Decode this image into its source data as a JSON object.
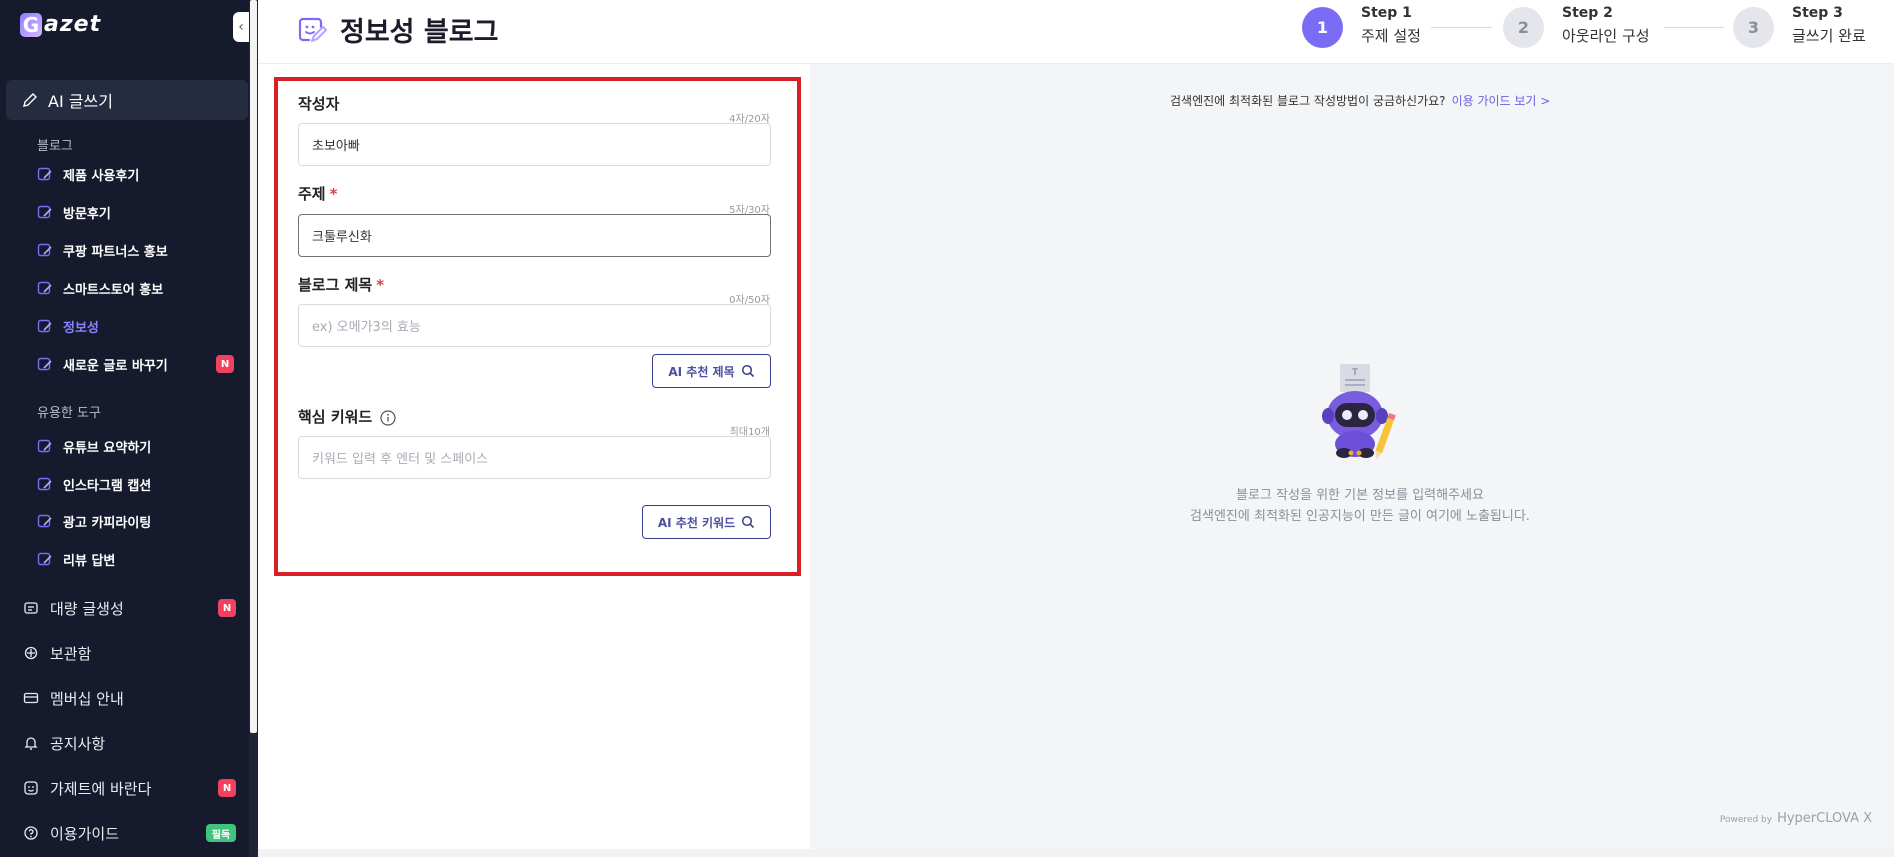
{
  "sidebar": {
    "logo": {
      "letter": "G",
      "text": "azet"
    },
    "collapse_glyph": "‹",
    "main_item": {
      "label": "AI 글쓰기",
      "icon": "pencil-icon"
    },
    "blog_section_label": "블로그",
    "blog_items": [
      {
        "label": "제품 사용후기"
      },
      {
        "label": "방문후기"
      },
      {
        "label": "쿠팡 파트너스 홍보"
      },
      {
        "label": "스마트스토어 홍보"
      },
      {
        "label": "정보성",
        "active": true
      },
      {
        "label": "새로운 글로 바꾸기",
        "badge": "N"
      }
    ],
    "tools_section_label": "유용한 도구",
    "tool_items": [
      {
        "label": "유튜브 요약하기"
      },
      {
        "label": "인스타그램 캡션"
      },
      {
        "label": "광고 카피라이팅"
      },
      {
        "label": "리뷰 답변"
      }
    ],
    "bottom_items": [
      {
        "label": "대량 글생성",
        "icon": "bulk-icon",
        "badge": "N"
      },
      {
        "label": "보관함",
        "icon": "archive-icon"
      },
      {
        "label": "멤버십 안내",
        "icon": "card-icon"
      },
      {
        "label": "공지사항",
        "icon": "bell-icon"
      },
      {
        "label": "가제트에 바란다",
        "icon": "feedback-icon",
        "badge": "N"
      },
      {
        "label": "이용가이드",
        "icon": "help-icon",
        "badge": "필독"
      }
    ]
  },
  "header": {
    "title": "정보성 블로그",
    "steps": [
      {
        "num": "1",
        "title": "Step 1",
        "label": "주제 설정",
        "active": true
      },
      {
        "num": "2",
        "title": "Step 2",
        "label": "아웃라인 구성",
        "active": false
      },
      {
        "num": "3",
        "title": "Step 3",
        "label": "글쓰기 완료",
        "active": false
      }
    ]
  },
  "form": {
    "author": {
      "label": "작성자",
      "counter": "4자/20자",
      "value": "초보아빠"
    },
    "topic": {
      "label": "주제",
      "required": "*",
      "counter": "5자/30자",
      "value": "크툴루신화"
    },
    "blog_title": {
      "label": "블로그 제목",
      "required": "*",
      "counter": "0자/50자",
      "placeholder": "ex) 오메가3의 효능"
    },
    "ai_title_button": "AI 추천 제목",
    "keywords": {
      "label": "핵심 키워드",
      "counter": "최대10개",
      "placeholder": "키워드 입력 후 엔터 및 스페이스"
    },
    "ai_keyword_button": "AI 추천 키워드"
  },
  "preview": {
    "guide_question": "검색엔진에 최적화된 블로그 작성방법이 궁금하신가요?",
    "guide_link": "이용 가이드 보기 >",
    "empty_line1": "블로그 작성을 위한 기본 정보를 입력해주세요",
    "empty_line2": "검색엔진에 최적화된 인공지능이 만든 글이 여기에 노출됩니다.",
    "powered_prefix": "Powered by",
    "powered_brand": "HyperCLOVA X"
  },
  "colors": {
    "sidebar_bg": "#151b2d",
    "accent": "#7b6cf6",
    "badge_red": "#f0415f",
    "badge_green": "#3fc47d",
    "highlight_border": "#d81f26"
  }
}
